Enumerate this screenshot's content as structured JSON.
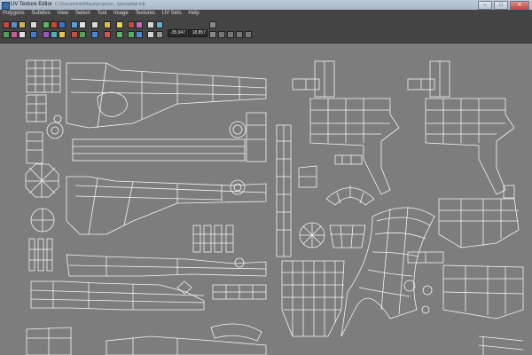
{
  "window": {
    "title": "UV Texture Editor",
    "path": "C:\\Documents\\Maya\\projects\\...\\grenadepl.mb",
    "minimize": "–",
    "maximize": "□",
    "close": "✕"
  },
  "menu": [
    "Polygons",
    "Subdivs",
    "View",
    "Select",
    "Tool",
    "Image",
    "Textures",
    "UV Sets",
    "Help"
  ],
  "toolbar": {
    "u_value": "-35.947",
    "v_value": "18.857",
    "icons": [
      "uv-grab-icon",
      "uv-move-icon",
      "uv-rotate-icon",
      "uv-scale-icon",
      "flip-u-icon",
      "flip-v-icon",
      "cut-uv-icon",
      "sew-uv-icon",
      "move-sew-icon",
      "layout-icon",
      "unfold-icon",
      "relax-icon",
      "grid-toggle-icon",
      "snap-icon",
      "dim-image-icon",
      "display-image-icon",
      "checker-icon",
      "shaded-uv-icon",
      "distortion-icon",
      "uv-border-icon",
      "texel-icon",
      "copy-uv-icon",
      "paste-uv-icon"
    ]
  },
  "colors": {
    "canvas": "#7d7d7d",
    "wire": "#f4f4f4",
    "ui_dark": "#444444"
  }
}
